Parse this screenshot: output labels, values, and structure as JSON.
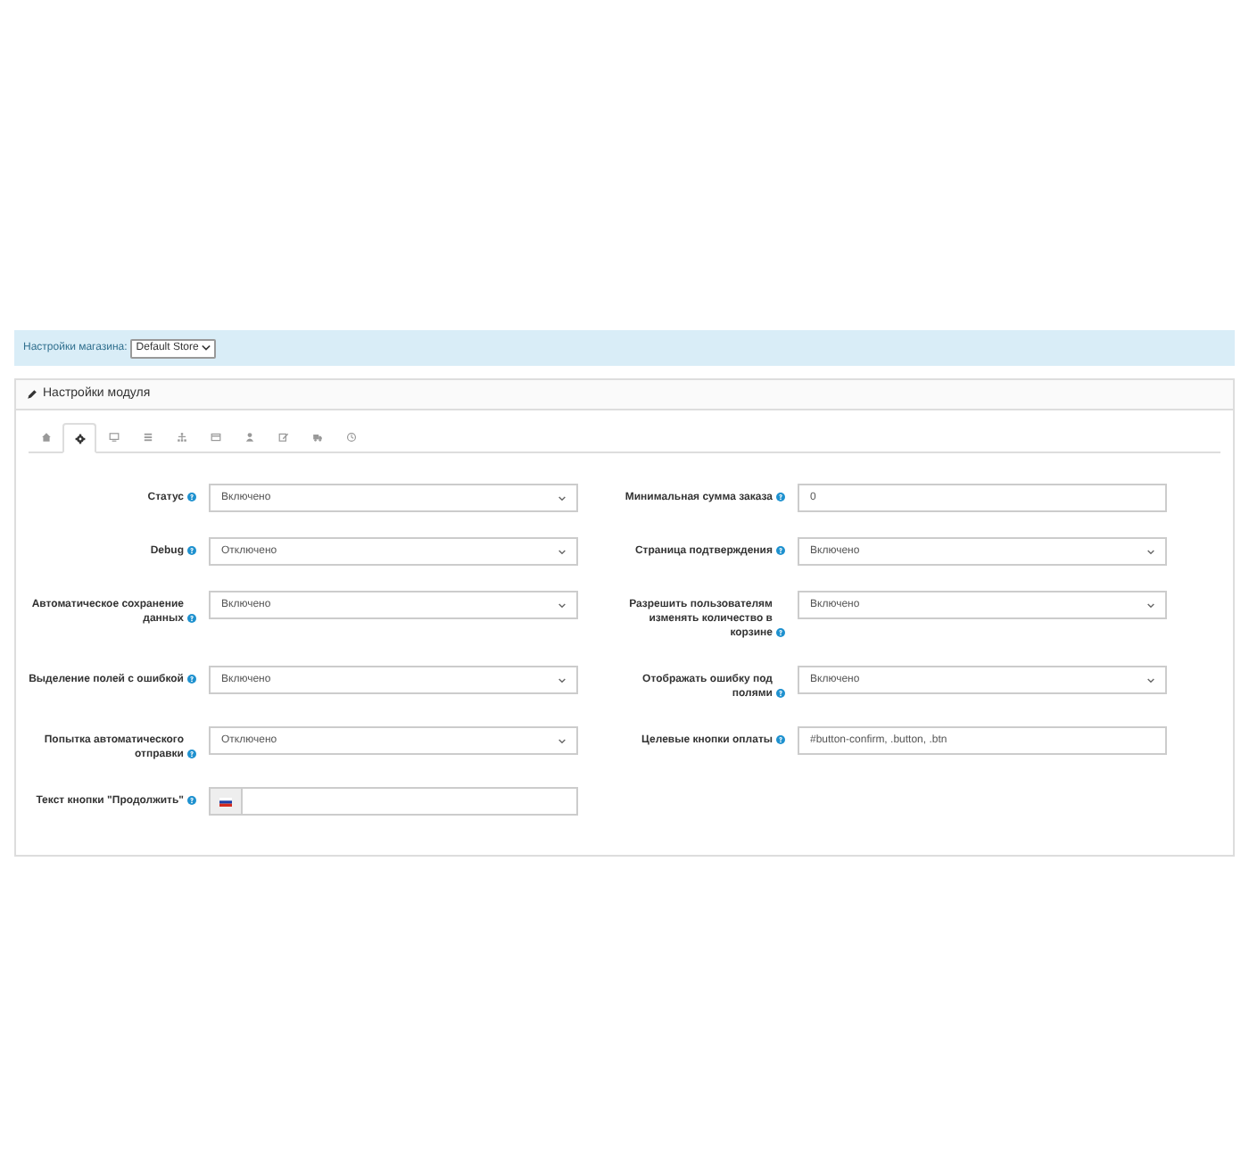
{
  "store_bar": {
    "label": "Настройки магазина:",
    "store_select": "Default Store"
  },
  "panel": {
    "title": "Настройки модуля"
  },
  "tabs": [
    {
      "selected": false
    },
    {
      "selected": true
    },
    {
      "selected": false
    },
    {
      "selected": false
    },
    {
      "selected": false
    },
    {
      "selected": false
    },
    {
      "selected": false
    },
    {
      "selected": false
    },
    {
      "selected": false
    },
    {
      "selected": false
    }
  ],
  "rows": [
    {
      "left": {
        "label": "Статус",
        "kind": "select",
        "value": "Включено"
      },
      "right": {
        "label": "Минимальная сумма заказа",
        "kind": "text",
        "value": "0"
      }
    },
    {
      "left": {
        "label": "Debug",
        "kind": "select",
        "value": "Отключено"
      },
      "right": {
        "label": "Страница подтверждения",
        "kind": "select",
        "value": "Включено"
      }
    },
    {
      "left": {
        "label": "Автоматическое сохранение данных",
        "kind": "select",
        "value": "Включено"
      },
      "right": {
        "label": "Разрешить пользователям изменять количество в корзине",
        "kind": "select",
        "value": "Включено"
      }
    },
    {
      "left": {
        "label": "Выделение полей с ошибкой",
        "kind": "select",
        "value": "Включено"
      },
      "right": {
        "label": "Отображать ошибку под полями",
        "kind": "select",
        "value": "Включено"
      }
    },
    {
      "left": {
        "label": "Попытка автоматического отправки",
        "kind": "select",
        "value": "Отключено"
      },
      "right": {
        "label": "Целевые кнопки оплаты",
        "kind": "text",
        "value": "#button-confirm, .button, .btn"
      }
    },
    {
      "left": {
        "label": "Текст кнопки \"Продолжить\"",
        "kind": "lang-text"
      }
    }
  ]
}
